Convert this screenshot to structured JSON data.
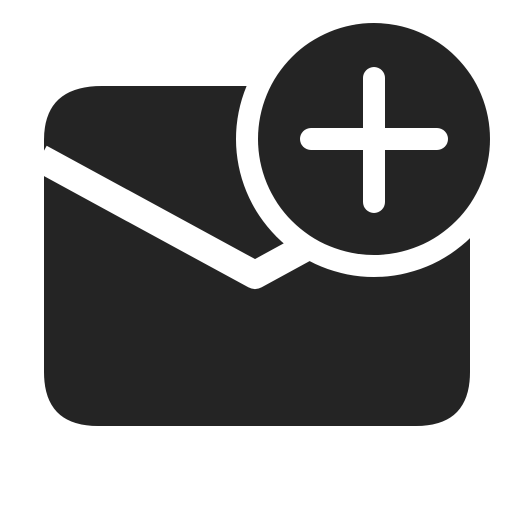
{
  "icon": {
    "name": "mail-add-icon",
    "parts": [
      "envelope-icon",
      "plus-badge-icon"
    ],
    "color": "#242424",
    "background": "#ffffff"
  }
}
